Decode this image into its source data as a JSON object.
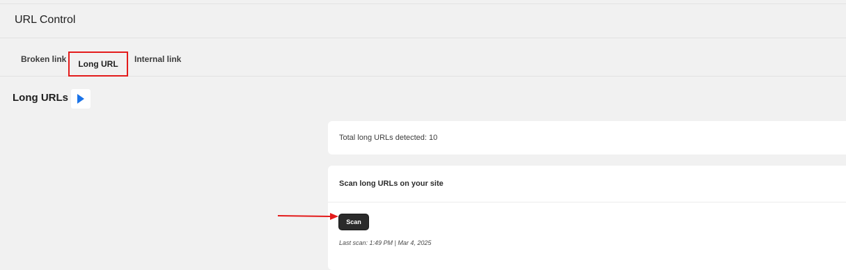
{
  "header": {
    "title": "URL Control"
  },
  "tabs": [
    {
      "label": "Broken link",
      "active": false
    },
    {
      "label": "Long URL",
      "active": true
    },
    {
      "label": "Internal link",
      "active": false
    }
  ],
  "section": {
    "heading": "Long URLs",
    "play_icon": "play-icon"
  },
  "summary": {
    "text": "Total long URLs detected: 10"
  },
  "scan": {
    "title": "Scan long URLs on your site",
    "button_label": "Scan",
    "last_scan": "Last scan: 1:49 PM | Mar 4, 2025"
  },
  "colors": {
    "highlight": "#e31b1b",
    "play": "#1a73e8",
    "button": "#2b2b2b"
  }
}
